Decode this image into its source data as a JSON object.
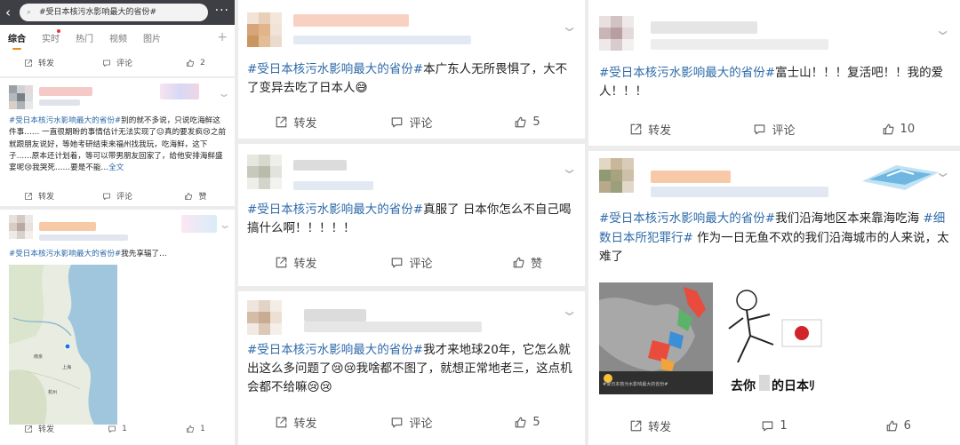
{
  "panel1": {
    "search_text": "#受日本核污水影响最大的省份#",
    "tabs": [
      "综合",
      "实时",
      "热门",
      "视频",
      "图片"
    ],
    "top_actions": {
      "repost": "转发",
      "comment": "评论",
      "like": "2"
    },
    "post1": {
      "hashtag": "#受日本核污水影响最大的省份#",
      "text": "别的就不多说，只说吃海鲜这件事…… 一直很期盼的事情估计无法实现了😐真的要发疯😢之前就跟朋友说好，等她考研结束来福州找我玩，吃海鲜，这下子……原本还计划着，等可以带男朋友回家了，给他安排海鲜盛宴呢😢我哭死……要是不能…",
      "more": "全文",
      "actions": {
        "repost": "转发",
        "comment": "评论",
        "like": "赞"
      }
    },
    "post2": {
      "hashtag": "#受日本核污水影响最大的省份#",
      "text": "我先享辐了…",
      "map_labels": [
        "南京",
        "上海",
        "杭州"
      ],
      "actions": {
        "repost": "转发",
        "comment": "1",
        "like": "1"
      }
    }
  },
  "panel2": {
    "posts": [
      {
        "hashtag": "#受日本核污水影响最大的省份#",
        "text": "本广东人无所畏惧了，大不了变异去吃了日本人😅",
        "actions": {
          "repost": "转发",
          "comment": "评论",
          "like": "5"
        }
      },
      {
        "hashtag": "#受日本核污水影响最大的省份#",
        "text": "真服了 日本你怎么不自己喝 搞什么啊！！！！！",
        "actions": {
          "repost": "转发",
          "comment": "评论",
          "like": "赞"
        }
      },
      {
        "hashtag": "#受日本核污水影响最大的省份#",
        "text": "我才来地球20年，它怎么就出这么多问题了😢😢我啥都不图了，就想正常地老三，这点机会都不给嘛😢😢",
        "actions": {
          "repost": "转发",
          "comment": "评论",
          "like": "5"
        }
      }
    ]
  },
  "panel3": {
    "post1": {
      "hashtag": "#受日本核污水影响最大的省份#",
      "text": "富士山！！！复活吧！！我的爱人！！！",
      "actions": {
        "repost": "转发",
        "comment": "评论",
        "like": "10"
      }
    },
    "post2": {
      "hashtag": "#受日本核污水影响最大的省份#",
      "text1": "我们沿海地区本来靠海吃海 ",
      "hashtag2": "#细数日本所犯罪行#",
      "text2": " 作为一日无鱼不欢的我们沿海城市的人来说，太难了",
      "image_caption": "去你",
      "image_caption_end": "的日本ﾘ",
      "image_small_text": "#受日本核污水影响最大的省份#",
      "actions": {
        "repost": "转发",
        "comment": "1",
        "like": "6"
      }
    }
  },
  "colors": {
    "hashtag": "#2e6aa8",
    "topbar": "#3d3f44",
    "tab_indicator": "#f08c1a"
  }
}
